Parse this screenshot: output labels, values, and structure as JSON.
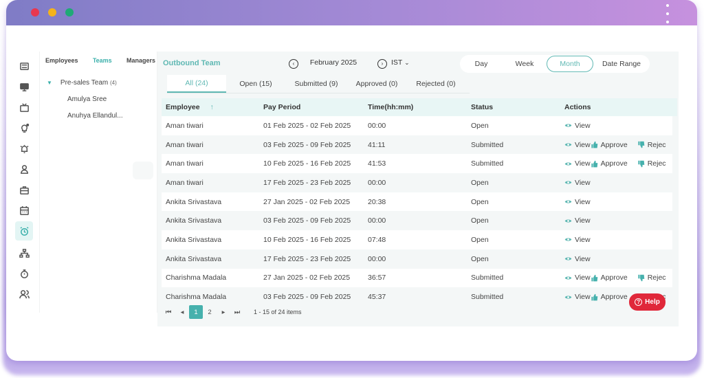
{
  "window": {
    "traffic_lights": [
      {
        "name": "close",
        "color": "#e8374f"
      },
      {
        "name": "minimize",
        "color": "#f4b31b"
      },
      {
        "name": "maximize",
        "color": "#1faa76"
      }
    ],
    "menu_icon": "kebab-menu-icon"
  },
  "sidebar_icons": [
    {
      "name": "ticket-icon",
      "active": false
    },
    {
      "name": "monitor-icon",
      "active": false
    },
    {
      "name": "tv-icon",
      "active": false
    },
    {
      "name": "lightbulb-icon",
      "active": false
    },
    {
      "name": "alarm-bell-icon",
      "active": false
    },
    {
      "name": "user-icon",
      "active": false
    },
    {
      "name": "briefcase-icon",
      "active": false
    },
    {
      "name": "calendar-icon",
      "active": false
    },
    {
      "name": "alarm-clock-icon",
      "active": true
    },
    {
      "name": "org-chart-icon",
      "active": false
    },
    {
      "name": "stopwatch-icon",
      "active": false
    },
    {
      "name": "users-icon",
      "active": false
    }
  ],
  "left_panel": {
    "tabs": [
      {
        "label": "Employees",
        "active": false
      },
      {
        "label": "Teams",
        "active": true
      },
      {
        "label": "Managers",
        "active": false
      }
    ],
    "team": {
      "name": "Pre-sales Team",
      "count": "(4)"
    },
    "members": [
      "Amulya Sree",
      "Anuhya Ellandul..."
    ]
  },
  "header": {
    "team_title": "Outbound Team",
    "prev_icon": "chevron-left-circle-icon",
    "period": "February 2025",
    "next_icon": "chevron-right-circle-icon",
    "timezone": "IST",
    "range_options": [
      {
        "label": "Day",
        "active": false
      },
      {
        "label": "Week",
        "active": false
      },
      {
        "label": "Month",
        "active": true
      },
      {
        "label": "Date Range",
        "active": false
      }
    ]
  },
  "status_tabs": [
    {
      "label": "All (24)",
      "active": true
    },
    {
      "label": "Open (15)",
      "active": false
    },
    {
      "label": "Submitted (9)",
      "active": false
    },
    {
      "label": "Approved (0)",
      "active": false
    },
    {
      "label": "Rejected (0)",
      "active": false
    }
  ],
  "table": {
    "columns": [
      "Employee",
      "Pay Period",
      "Time(hh:mm)",
      "Status",
      "Actions"
    ],
    "sort_icon": "sort-ascending-icon",
    "action_labels": {
      "view": "View",
      "approve": "Approve",
      "reject": "Rejec"
    },
    "rows": [
      {
        "employee": "Aman tiwari",
        "period": "01 Feb 2025 - 02 Feb 2025",
        "time": "00:00",
        "status": "Open"
      },
      {
        "employee": "Aman tiwari",
        "period": "03 Feb 2025 - 09 Feb 2025",
        "time": "41:11",
        "status": "Submitted"
      },
      {
        "employee": "Aman tiwari",
        "period": "10 Feb 2025 - 16 Feb 2025",
        "time": "41:53",
        "status": "Submitted"
      },
      {
        "employee": "Aman tiwari",
        "period": "17 Feb 2025 - 23 Feb 2025",
        "time": "00:00",
        "status": "Open"
      },
      {
        "employee": "Ankita Srivastava",
        "period": "27 Jan 2025 - 02 Feb 2025",
        "time": "20:38",
        "status": "Open"
      },
      {
        "employee": "Ankita Srivastava",
        "period": "03 Feb 2025 - 09 Feb 2025",
        "time": "00:00",
        "status": "Open"
      },
      {
        "employee": "Ankita Srivastava",
        "period": "10 Feb 2025 - 16 Feb 2025",
        "time": "07:48",
        "status": "Open"
      },
      {
        "employee": "Ankita Srivastava",
        "period": "17 Feb 2025 - 23 Feb 2025",
        "time": "00:00",
        "status": "Open"
      },
      {
        "employee": "Charishma Madala",
        "period": "27 Jan 2025 - 02 Feb 2025",
        "time": "36:57",
        "status": "Submitted"
      },
      {
        "employee": "Charishma Madala",
        "period": "03 Feb 2025 - 09 Feb 2025",
        "time": "45:37",
        "status": "Submitted"
      }
    ]
  },
  "pager": {
    "pages": [
      "1",
      "2"
    ],
    "current_page": "1",
    "summary": "1 - 15 of 24 items"
  },
  "help_button": {
    "label": "Help"
  },
  "colors": {
    "accent": "#5fb8b3",
    "accent_dark": "#46b1ad",
    "help_red": "#e0283a"
  }
}
